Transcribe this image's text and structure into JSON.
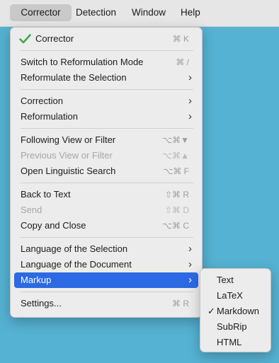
{
  "menubar": {
    "items": [
      {
        "label": "Corrector"
      },
      {
        "label": "Detection"
      },
      {
        "label": "Window"
      },
      {
        "label": "Help"
      }
    ]
  },
  "menu": {
    "corrector": {
      "label": "Corrector",
      "shortcut": "⌘ K",
      "checked": true
    },
    "switch_mode": {
      "label": "Switch to Reformulation Mode",
      "shortcut": "⌘ /"
    },
    "reformulate_selection": {
      "label": "Reformulate the Selection"
    },
    "correction": {
      "label": "Correction"
    },
    "reformulation": {
      "label": "Reformulation"
    },
    "following_view": {
      "label": "Following View or Filter",
      "shortcut": "⌥⌘▼"
    },
    "previous_view": {
      "label": "Previous View or Filter",
      "shortcut": "⌥⌘▲",
      "disabled": true
    },
    "linguistic_search": {
      "label": "Open Linguistic Search",
      "shortcut": "⌥⌘ F"
    },
    "back_to_text": {
      "label": "Back to Text",
      "shortcut": "⇧⌘ R"
    },
    "send": {
      "label": "Send",
      "shortcut": "⇧⌘ D",
      "disabled": true
    },
    "copy_close": {
      "label": "Copy and Close",
      "shortcut": "⌥⌘ C"
    },
    "language_selection": {
      "label": "Language of the Selection"
    },
    "language_document": {
      "label": "Language of the Document"
    },
    "markup": {
      "label": "Markup",
      "highlighted": true
    },
    "settings": {
      "label": "Settings...",
      "shortcut": "⌘ R"
    }
  },
  "markup_submenu": {
    "items": [
      {
        "label": "Text"
      },
      {
        "label": "LaTeX"
      },
      {
        "label": "Markdown",
        "checked": true
      },
      {
        "label": "SubRip"
      },
      {
        "label": "HTML"
      }
    ],
    "check_glyph": "✓"
  },
  "colors": {
    "desktop": "#55b2d2",
    "highlight": "#2c6ae3",
    "check_green": "#3aa94a"
  },
  "icons": {
    "submenu_arrow": "chevron-right-icon",
    "checked": "checkmark-icon"
  }
}
